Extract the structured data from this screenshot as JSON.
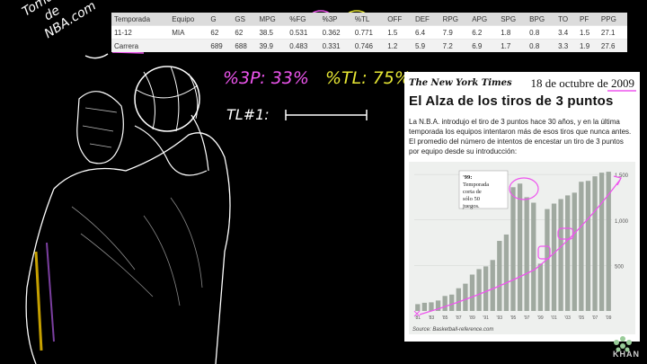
{
  "source_note": [
    "Tomado",
    "de",
    "NBA.com"
  ],
  "stats_table": {
    "headers": [
      "Temporada",
      "Equipo",
      "G",
      "GS",
      "MPG",
      "%FG",
      "%3P",
      "%TL",
      "OFF",
      "DEF",
      "RPG",
      "APG",
      "SPG",
      "BPG",
      "TO",
      "PF",
      "PPG"
    ],
    "rows": [
      [
        "11-12",
        "MIA",
        "62",
        "62",
        "38.5",
        "0.531",
        "0.362",
        "0.771",
        "1.5",
        "6.4",
        "7.9",
        "6.2",
        "1.8",
        "0.8",
        "3.4",
        "1.5",
        "27.1"
      ],
      [
        "Carrera",
        "",
        "689",
        "688",
        "39.9",
        "0.483",
        "0.331",
        "0.746",
        "1.2",
        "5.9",
        "7.2",
        "6.9",
        "1.7",
        "0.8",
        "3.3",
        "1.9",
        "27.6"
      ]
    ]
  },
  "annotations": {
    "pct3": "%3P: 33%",
    "pctTL": "%TL: 75%",
    "tl1": "TL#1:"
  },
  "article": {
    "masthead": "The New York Times",
    "date": "18 de octubre de 2009",
    "title": "El Alza de los tiros de 3 puntos",
    "body": "La N.B.A. introdujo el tiro de 3 puntos hace 30 años, y en la última temporada los equipos intentaron más de esos tiros que nunca antes. El promedio del número de intentos de encestar un tiro de 3 puntos por equipo desde su introducción:",
    "source": "Source: Basketball-reference.com"
  },
  "chart_data": {
    "type": "bar",
    "categories": [
      "'81",
      "'82",
      "'83",
      "'84",
      "'85",
      "'86",
      "'87",
      "'88",
      "'89",
      "'90",
      "'91",
      "'92",
      "'93",
      "'94",
      "'95",
      "'96",
      "'97",
      "'98",
      "'99",
      "'00",
      "'01",
      "'02",
      "'03",
      "'04",
      "'05",
      "'06",
      "'07",
      "'08",
      "'09"
    ],
    "x_tick_labels": [
      "'81",
      "'83",
      "'85",
      "'87",
      "'89",
      "'91",
      "'93",
      "'95",
      "'97",
      "'99",
      "'01",
      "'03",
      "'05",
      "'07",
      "'09"
    ],
    "values": [
      75,
      90,
      95,
      115,
      165,
      180,
      250,
      300,
      400,
      460,
      490,
      560,
      770,
      840,
      1360,
      1400,
      1250,
      1190,
      520,
      1120,
      1180,
      1230,
      1270,
      1300,
      1420,
      1430,
      1480,
      1520,
      1530
    ],
    "ylim": [
      0,
      1600
    ],
    "y_ticks": [
      500,
      1000,
      1500
    ],
    "y_tick_labels": [
      "500",
      "1,000",
      "1,500"
    ],
    "callout": "'99: Temporada corta de sólo 50 juegos.",
    "bar_color": "#a0a9a0"
  },
  "branding": "KHAN"
}
